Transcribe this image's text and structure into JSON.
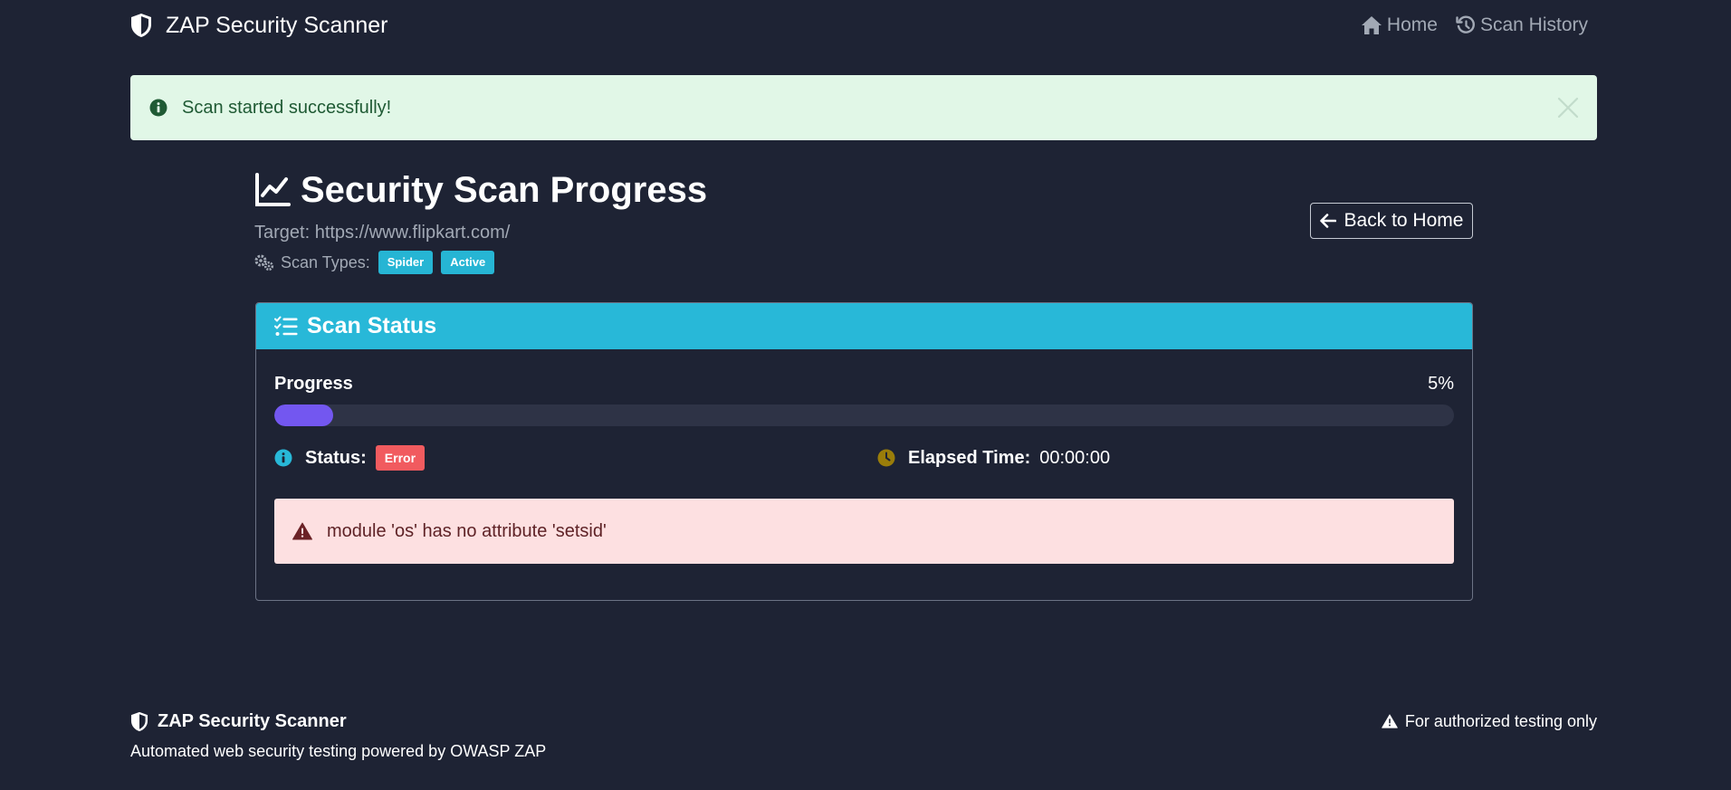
{
  "navbar": {
    "brand": "ZAP Security Scanner",
    "brand_icon": "shield-icon",
    "links": [
      {
        "label": "Home",
        "icon": "home-icon"
      },
      {
        "label": "Scan History",
        "icon": "history-icon"
      }
    ]
  },
  "alert": {
    "message": "Scan started successfully!",
    "icon": "info-circle-icon"
  },
  "header": {
    "title": "Security Scan Progress",
    "title_icon": "chart-line-icon",
    "target": "Target: https://www.flipkart.com/",
    "scan_types_label": "Scan Types:",
    "scan_types": [
      "Spider",
      "Active"
    ],
    "back_button": "Back to Home"
  },
  "card": {
    "title": "Scan Status",
    "progress_label": "Progress",
    "progress_value": "5%",
    "progress_fraction": 0.05,
    "status_label": "Status:",
    "status_value": "Error",
    "elapsed_label": "Elapsed Time:",
    "elapsed_value": "00:00:00",
    "error_message": "module 'os' has no attribute 'setsid'"
  },
  "footer": {
    "brand": "ZAP Security Scanner",
    "subtitle": "Automated web security testing powered by OWASP ZAP",
    "note": "For authorized testing only"
  },
  "colors": {
    "background": "#1e2334",
    "card_header": "#28b8d8",
    "badge_info": "#26b5d4",
    "progress_fill": "#7357f0",
    "error_badge": "#f15b5f",
    "success_alert": "#e1f7e7",
    "danger_alert": "#fde0e1",
    "clock_icon": "#9a7d0a"
  }
}
